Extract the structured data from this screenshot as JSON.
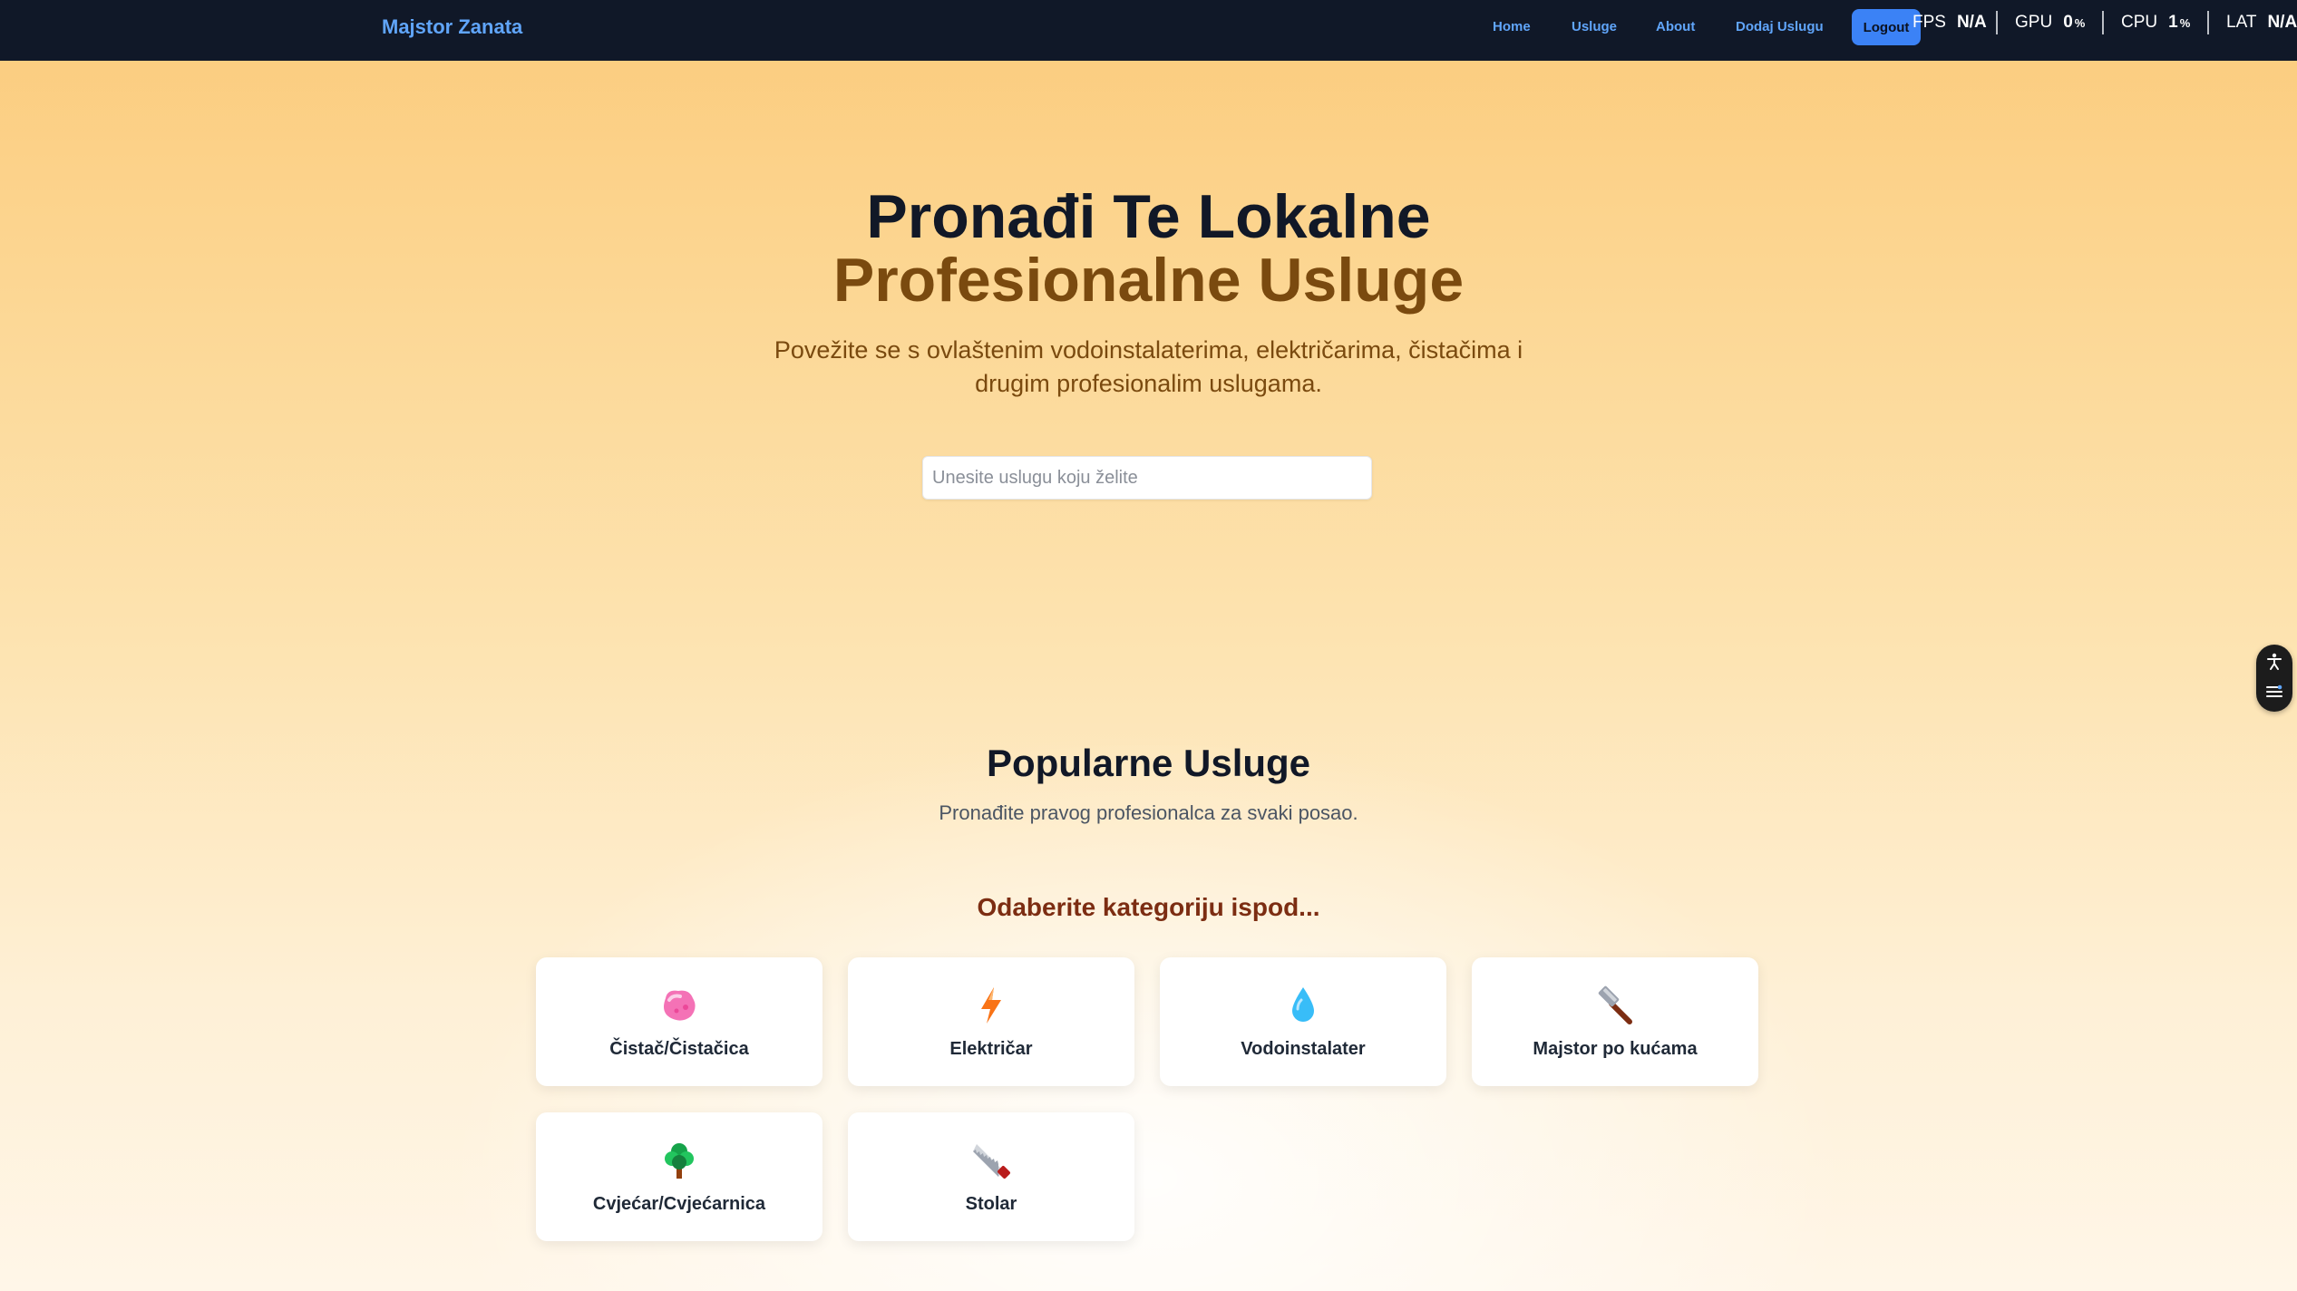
{
  "navbar": {
    "brand": "Majstor Zanata",
    "links": [
      "Home",
      "Usluge",
      "About",
      "Dodaj Uslugu"
    ],
    "logout_label": "Logout",
    "colors": {
      "background": "#101828",
      "link": "#60a5fa",
      "button": "#3b82f6"
    }
  },
  "perf_overlay": {
    "fps": {
      "label": "FPS",
      "value": "N/A"
    },
    "gpu": {
      "label": "GPU",
      "value": "0",
      "unit": "%"
    },
    "cpu": {
      "label": "CPU",
      "value": "1",
      "unit": "%"
    },
    "lat": {
      "label": "LAT",
      "value": "N/A"
    }
  },
  "hero": {
    "title_line1": "Pronađi Te Lokalne",
    "title_line2": "Profesionalne Usluge",
    "subtitle": "Povežite se s ovlaštenim vodoinstalaterima, električarima, čistačima i drugim profesionalim uslugama.",
    "search_placeholder": "Unesite uslugu koju želite"
  },
  "side_widget": {
    "icons": [
      "accessibility-icon",
      "settings-sliders-icon"
    ]
  },
  "popular": {
    "title": "Popularne Usluge",
    "subtitle": "Pronađite pravog profesionalca za svaki posao.",
    "category_prompt": "Odaberite kategoriju ispod...",
    "categories": [
      {
        "label": "Čistač/Čistačica",
        "icon": "sponge-icon"
      },
      {
        "label": "Električar",
        "icon": "lightning-icon"
      },
      {
        "label": "Vodoinstalater",
        "icon": "water-drop-icon"
      },
      {
        "label": "Majstor po kućama",
        "icon": "hammer-icon"
      },
      {
        "label": "Cvjećar/Cvjećarnica",
        "icon": "tree-icon"
      },
      {
        "label": "Stolar",
        "icon": "saw-icon"
      }
    ]
  }
}
